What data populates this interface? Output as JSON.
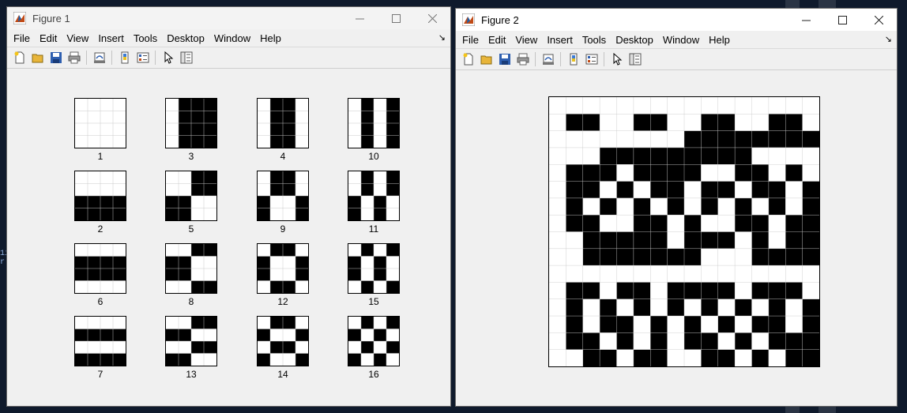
{
  "figure1": {
    "title": "Figure 1",
    "menu": [
      "File",
      "Edit",
      "View",
      "Insert",
      "Tools",
      "Desktop",
      "Window",
      "Help"
    ],
    "toolbar_icons": [
      "new-figure-icon",
      "open-file-icon",
      "save-icon",
      "print-icon",
      "link-plot-icon",
      "insert-colorbar-icon",
      "insert-legend-icon",
      "edit-plot-icon",
      "property-inspector-icon"
    ],
    "patterns": [
      {
        "label": "1",
        "cols": [
          0,
          0,
          0,
          0
        ],
        "rows": [
          0,
          0,
          0,
          0
        ]
      },
      {
        "label": "3",
        "cols": [
          0,
          1,
          1,
          1
        ],
        "rows": [
          0,
          0,
          0,
          0
        ]
      },
      {
        "label": "4",
        "cols": [
          0,
          1,
          1,
          0
        ],
        "rows": [
          0,
          0,
          0,
          0
        ]
      },
      {
        "label": "10",
        "cols": [
          0,
          1,
          0,
          1
        ],
        "rows": [
          0,
          0,
          0,
          0
        ]
      },
      {
        "label": "2",
        "cols": [
          0,
          0,
          0,
          0
        ],
        "rows": [
          0,
          0,
          1,
          1
        ]
      },
      {
        "label": "5",
        "cols": [
          0,
          0,
          1,
          1
        ],
        "rows": [
          0,
          0,
          1,
          1
        ]
      },
      {
        "label": "9",
        "cols": [
          0,
          1,
          1,
          0
        ],
        "rows": [
          0,
          0,
          1,
          1
        ]
      },
      {
        "label": "11",
        "cols": [
          0,
          1,
          0,
          1
        ],
        "rows": [
          0,
          0,
          1,
          1
        ]
      },
      {
        "label": "6",
        "cols": [
          0,
          0,
          0,
          0
        ],
        "rows": [
          0,
          1,
          1,
          0
        ]
      },
      {
        "label": "8",
        "cols": [
          0,
          0,
          1,
          1
        ],
        "rows": [
          0,
          1,
          1,
          0
        ]
      },
      {
        "label": "12",
        "cols": [
          0,
          1,
          1,
          0
        ],
        "rows": [
          0,
          1,
          1,
          0
        ]
      },
      {
        "label": "15",
        "cols": [
          0,
          1,
          0,
          1
        ],
        "rows": [
          0,
          1,
          1,
          0
        ]
      },
      {
        "label": "7",
        "cols": [
          0,
          0,
          0,
          0
        ],
        "rows": [
          0,
          1,
          0,
          1
        ]
      },
      {
        "label": "13",
        "cols": [
          0,
          0,
          1,
          1
        ],
        "rows": [
          0,
          1,
          0,
          1
        ]
      },
      {
        "label": "14",
        "cols": [
          0,
          1,
          1,
          0
        ],
        "rows": [
          0,
          1,
          0,
          1
        ]
      },
      {
        "label": "16",
        "cols": [
          0,
          1,
          0,
          1
        ],
        "rows": [
          0,
          1,
          0,
          1
        ]
      }
    ]
  },
  "figure2": {
    "title": "Figure 2",
    "menu": [
      "File",
      "Edit",
      "View",
      "Insert",
      "Tools",
      "Desktop",
      "Window",
      "Help"
    ],
    "toolbar_icons": [
      "new-figure-icon",
      "open-file-icon",
      "save-icon",
      "print-icon",
      "link-plot-icon",
      "insert-colorbar-icon",
      "insert-legend-icon",
      "edit-plot-icon",
      "property-inspector-icon"
    ],
    "grid": [
      "0000000000000000",
      "0220022002200220",
      "0000000022222222",
      "0002222222220000",
      "0222022220022020",
      "0220202202202202",
      "0202020202020202",
      "0220022020022022",
      "0022222022202022",
      "0022222220002222",
      "0000000000000000",
      "0220220222202220",
      "0202020202020202",
      "0202202020202202",
      "0220202022020222",
      "0022022002202022"
    ]
  },
  "colors": {
    "on": "#000000",
    "off": "#ffffff",
    "gridline": "#c8c8c8"
  }
}
